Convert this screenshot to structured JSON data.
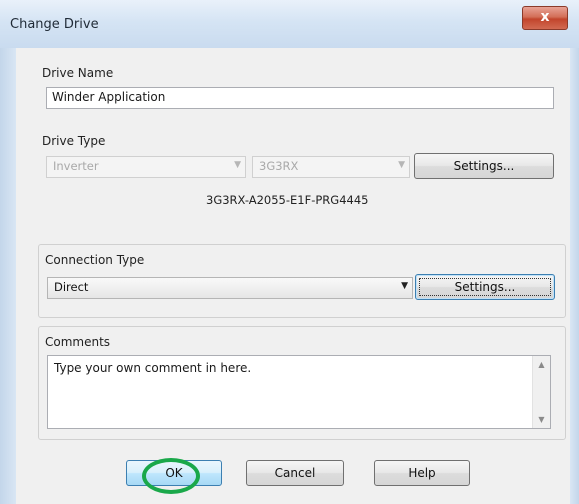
{
  "window": {
    "title": "Change Drive",
    "close_label": "x"
  },
  "drive_name": {
    "label": "Drive Name",
    "value": "Winder Application"
  },
  "drive_type": {
    "label": "Drive Type",
    "type_value": "Inverter",
    "model_value": "3G3RX",
    "settings_label": "Settings...",
    "part_number": "3G3RX-A2055-E1F-PRG4445"
  },
  "connection_type": {
    "label": "Connection Type",
    "value": "Direct",
    "settings_label": "Settings..."
  },
  "comments": {
    "label": "Comments",
    "text": "Type your own comment in here."
  },
  "buttons": {
    "ok": "OK",
    "cancel": "Cancel",
    "help": "Help"
  },
  "highlight": {
    "color": "#1aa84a",
    "target": "OK"
  }
}
